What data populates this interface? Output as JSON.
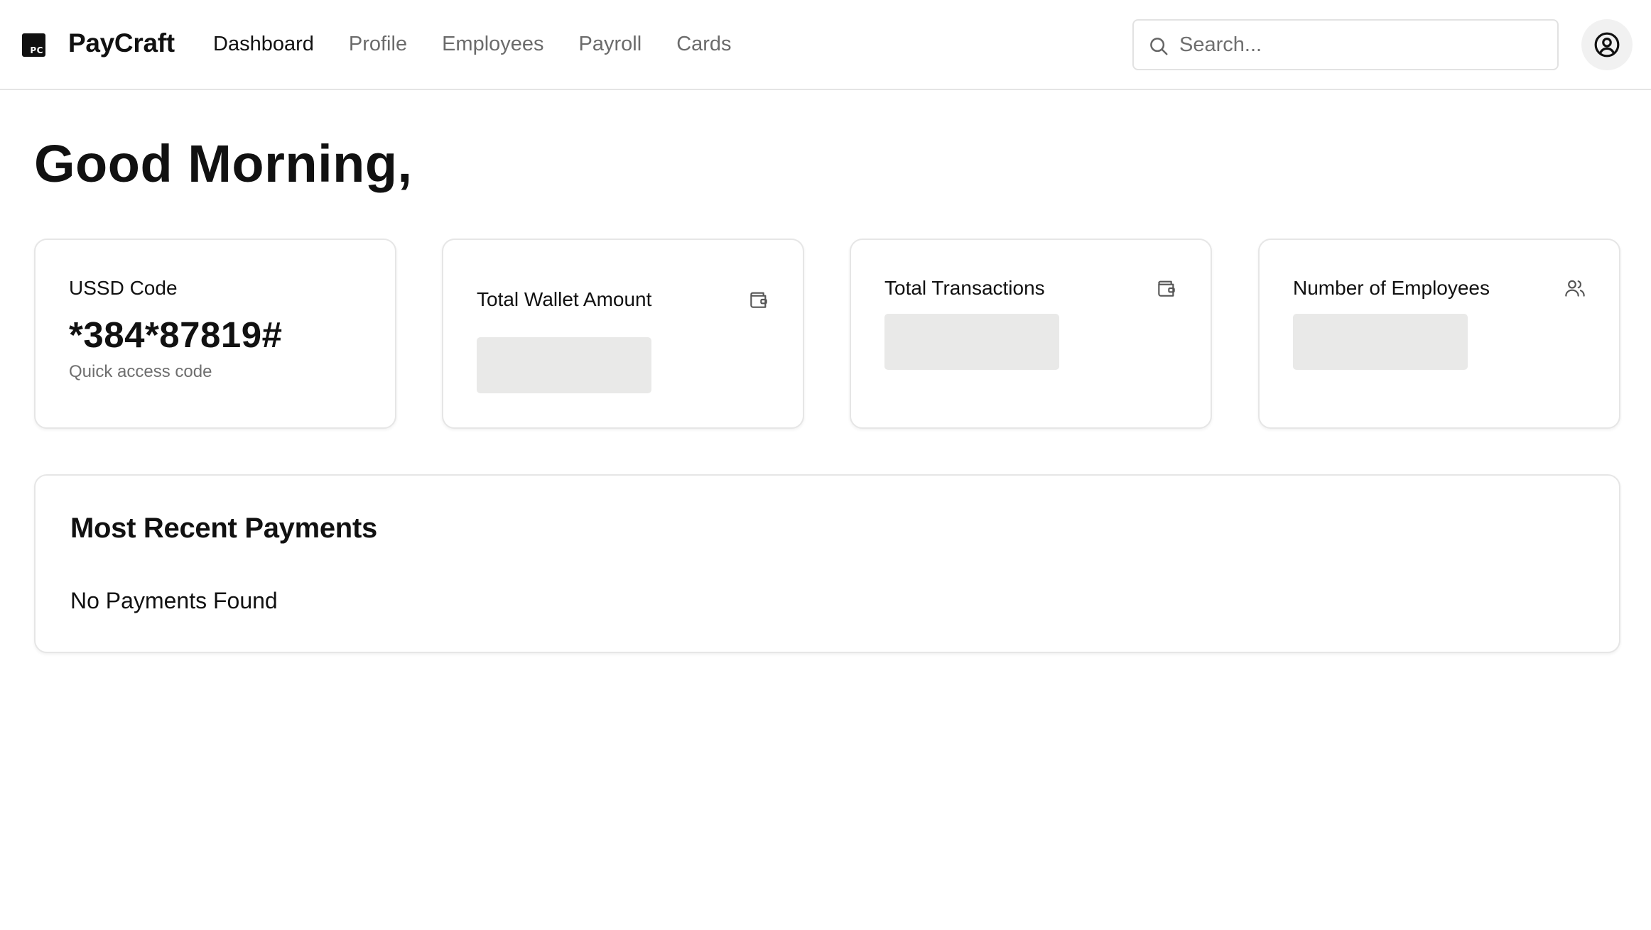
{
  "app": {
    "logo_text": "PC",
    "brand": "PayCraft"
  },
  "nav": {
    "items": [
      {
        "label": "Dashboard",
        "active": true
      },
      {
        "label": "Profile",
        "active": false
      },
      {
        "label": "Employees",
        "active": false
      },
      {
        "label": "Payroll",
        "active": false
      },
      {
        "label": "Cards",
        "active": false
      }
    ]
  },
  "search": {
    "placeholder": "Search...",
    "value": "",
    "icon": "search-icon"
  },
  "user": {
    "icon": "user-circle-icon"
  },
  "main": {
    "greeting": "Good Morning,"
  },
  "cards": {
    "ussd": {
      "title": "USSD Code",
      "value": "*384*87819#",
      "subtitle": "Quick access code"
    },
    "wallet": {
      "title": "Total Wallet Amount",
      "icon": "wallet-icon",
      "loading": true
    },
    "transactions": {
      "title": "Total Transactions",
      "icon": "wallet-icon",
      "loading": true
    },
    "employees": {
      "title": "Number of Employees",
      "icon": "users-icon",
      "loading": true
    }
  },
  "payments": {
    "title": "Most Recent Payments",
    "empty_message": "No Payments Found"
  },
  "colors": {
    "text": "#111111",
    "muted": "#6b6b6b",
    "border": "#e6e6e6",
    "skeleton": "#e9e9e8"
  }
}
